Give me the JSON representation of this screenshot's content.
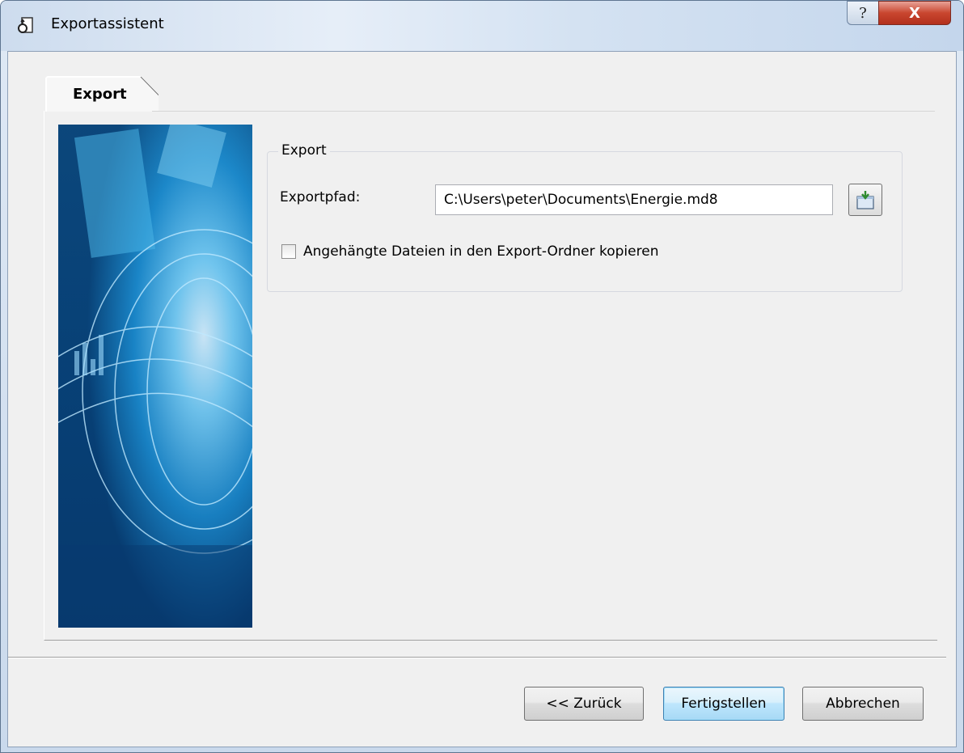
{
  "window": {
    "title": "Exportassistent",
    "icon": "export-document-icon",
    "help_symbol": "?",
    "close_symbol": "X"
  },
  "tab": {
    "label": "Export"
  },
  "group": {
    "legend": "Export",
    "path_label": "Exportpfad:",
    "path_value": "C:\\Users\\peter\\Documents\\Energie.md8",
    "browse_icon": "folder-browse-icon",
    "checkbox_label": "Angehängte Dateien in den Export-Ordner kopieren",
    "checkbox_checked": false
  },
  "buttons": {
    "back": "<< Zurück",
    "finish": "Fertigstellen",
    "cancel": "Abbrechen"
  },
  "colors": {
    "dialog_bg": "#f0f0f0",
    "close_red": "#c9462f",
    "default_button": "#a7d9f5"
  }
}
